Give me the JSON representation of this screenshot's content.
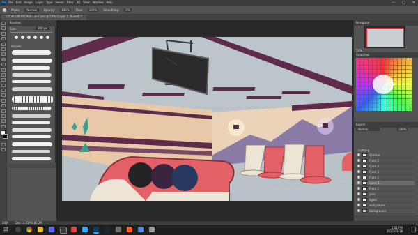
{
  "menubar": {
    "app_logo": "Ps",
    "items": [
      "File",
      "Edit",
      "Image",
      "Layer",
      "Type",
      "Select",
      "Filter",
      "3D",
      "View",
      "Window",
      "Help"
    ],
    "window_controls": [
      "—",
      "□",
      "✕"
    ]
  },
  "options_bar": {
    "items": [
      "Mode:",
      "Normal",
      "Opacity:",
      "100%",
      "Flow:",
      "100%",
      "Smoothing:",
      "0%"
    ]
  },
  "document": {
    "tab_title": "LOCATION ARCADE LEFT.psd @ 50% (Layer 1, RGB/8) *"
  },
  "brushes_panel": {
    "title": "Brushes",
    "size_label": "Size:",
    "size_value": "300 px",
    "folder_label": "Arcade"
  },
  "navigator": {
    "title": "Navigator",
    "zoom": "50%"
  },
  "swatches": {
    "title": "Swatches",
    "colors": [
      "#ff0000",
      "#ff8800",
      "#ffff00",
      "#00ff00",
      "#00ffff",
      "#0000ff",
      "#ff00ff",
      "#ffffff",
      "#000000",
      "#888888"
    ]
  },
  "layers_panel": {
    "title": "Layers",
    "blend_mode": "Normal",
    "opacity": "100%",
    "group_name": "Lighting",
    "layers": [
      {
        "name": "Shadow",
        "selected": false
      },
      {
        "name": "Front 5",
        "selected": false
      },
      {
        "name": "Front 4",
        "selected": false
      },
      {
        "name": "Front 3",
        "selected": false
      },
      {
        "name": "Front 2",
        "selected": false
      },
      {
        "name": "Layer 1",
        "selected": true
      },
      {
        "name": "Front 1",
        "selected": false
      },
      {
        "name": "pres",
        "selected": false
      },
      {
        "name": "lights",
        "selected": false
      },
      {
        "name": "wall planes",
        "selected": false
      },
      {
        "name": "Background",
        "selected": false
      }
    ]
  },
  "statusbar": {
    "zoom": "50%",
    "doc_info": "Doc: 3.35M/185.2M"
  },
  "taskbar": {
    "time": "2:51 PM",
    "date": "2022-03-18"
  },
  "colors": {
    "wall": "#b9c3c7",
    "trim_purple": "#5e2c4a",
    "chair_red": "#e36066",
    "chair_cream": "#ece5d6",
    "teal": "#3aa092"
  }
}
